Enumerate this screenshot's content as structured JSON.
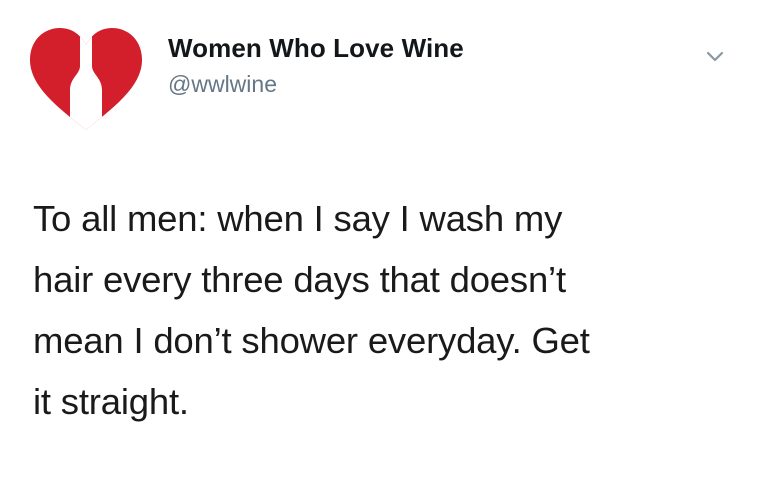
{
  "account": {
    "display_name": "Women Who Love Wine",
    "handle": "@wwlwine",
    "avatar_icon": "wine-bottle-heart-logo-icon",
    "brand_color": "#d21f2b"
  },
  "menu": {
    "icon": "chevron-down-icon"
  },
  "tweet": {
    "lines": [
      "To all men: when I say I wash my",
      "hair every three days that doesn’t",
      "mean I don’t shower everyday. Get",
      "it straight."
    ]
  }
}
